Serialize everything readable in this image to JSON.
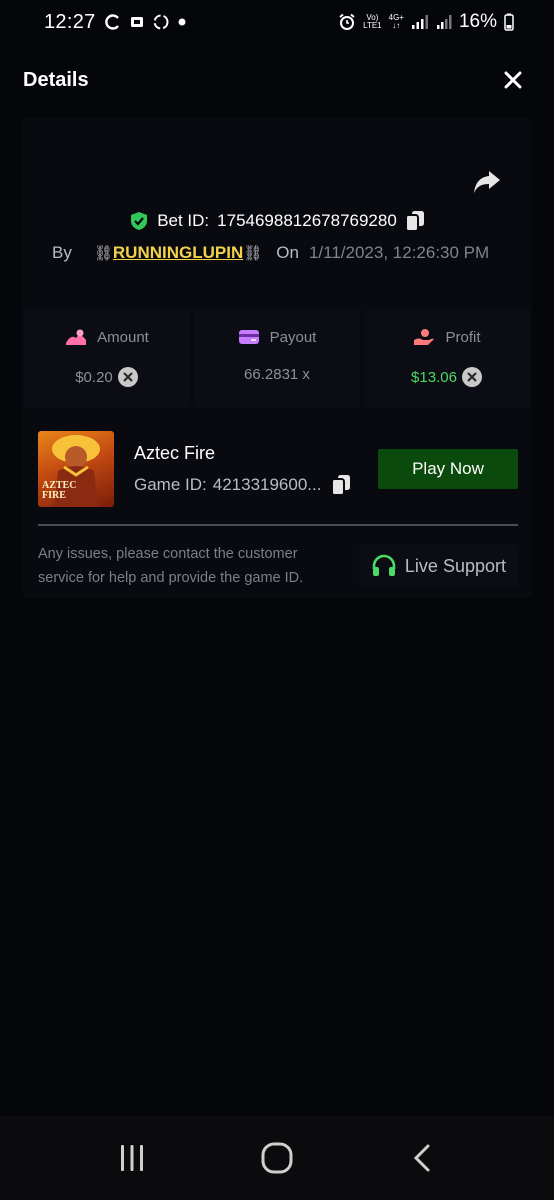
{
  "status_bar": {
    "time": "12:27",
    "network_top": "Vo)",
    "network_bottom": "LTE1",
    "network_type": "4G+",
    "battery": "16%"
  },
  "header": {
    "title": "Details"
  },
  "bet": {
    "id_label": "Bet ID:",
    "id_value": "1754698812678769280",
    "by_label": "By",
    "username": "RUNNINGLUPIN",
    "on_label": "On",
    "timestamp": "1/11/2023, 12:26:30 PM"
  },
  "stats": {
    "amount_label": "Amount",
    "amount_value": "$0.20",
    "payout_label": "Payout",
    "payout_value": "66.2831 x",
    "profit_label": "Profit",
    "profit_value": "$13.06"
  },
  "game": {
    "name": "Aztec Fire",
    "id_label": "Game ID:",
    "id_value": "4213319600...",
    "thumb_text_line1": "AZTEC",
    "thumb_text_line2": "FIRE",
    "play_button": "Play Now"
  },
  "support": {
    "help_text": "Any issues, please contact the customer service for help and provide the game ID.",
    "button_label": "Live Support"
  },
  "colors": {
    "accent_green": "#4cd964",
    "username_yellow": "#f3d24a",
    "play_button_bg": "#0a4a0c",
    "amount_icon": "#ff6fa8",
    "payout_icon": "#c77dff",
    "profit_icon": "#ff7a7a"
  },
  "icons": [
    "close-icon",
    "share-icon",
    "shield-check-icon",
    "copy-icon",
    "coin-icon",
    "card-icon",
    "hand-coin-icon",
    "x-circle-icon",
    "headset-icon",
    "recent-apps-icon",
    "home-icon",
    "back-icon"
  ]
}
